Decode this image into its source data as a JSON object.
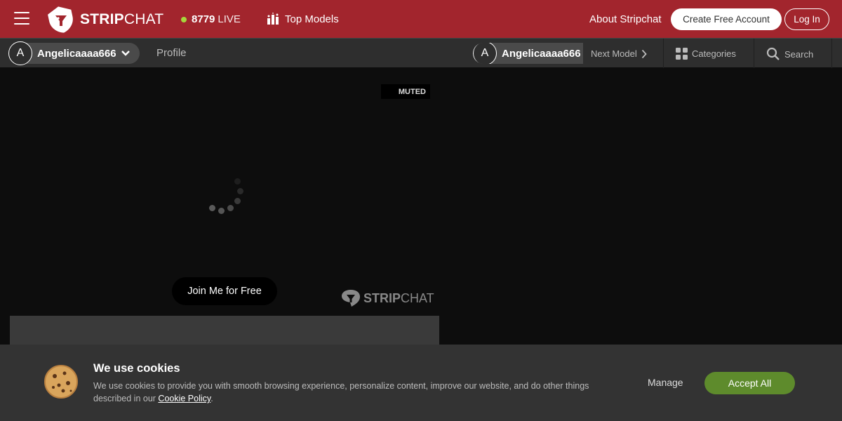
{
  "header": {
    "logo_bold": "STRIP",
    "logo_light": "CHAT",
    "live_count": "8779",
    "live_label": "LIVE",
    "top_models_label": "Top Models",
    "about_label": "About Stripchat",
    "create_account_label": "Create Free Account",
    "login_label": "Log In",
    "brand_color": "#a2252d",
    "live_dot_color": "#a6d63c"
  },
  "subbar": {
    "avatar_letter": "A",
    "model_name": "Angelicaaaa666",
    "profile_tab": "Profile",
    "avatar_letter_2": "A",
    "model_name_2": "Angelicaaaa666",
    "next_model_label": "Next Model",
    "categories_label": "Categories",
    "search_label": "Search"
  },
  "video": {
    "muted_label": "MUTED",
    "join_button_label": "Join Me for Free",
    "watermark_bold": "STRIP",
    "watermark_light": "CHAT"
  },
  "cookie": {
    "title": "We use cookies",
    "text": "We use cookies to provide you with smooth browsing experience, personalize content, improve our website, and do other things described in our ",
    "policy_link": "Cookie Policy",
    "text_end": ".",
    "manage_label": "Manage",
    "accept_label": "Accept All",
    "accept_color": "#5e8b2c"
  }
}
